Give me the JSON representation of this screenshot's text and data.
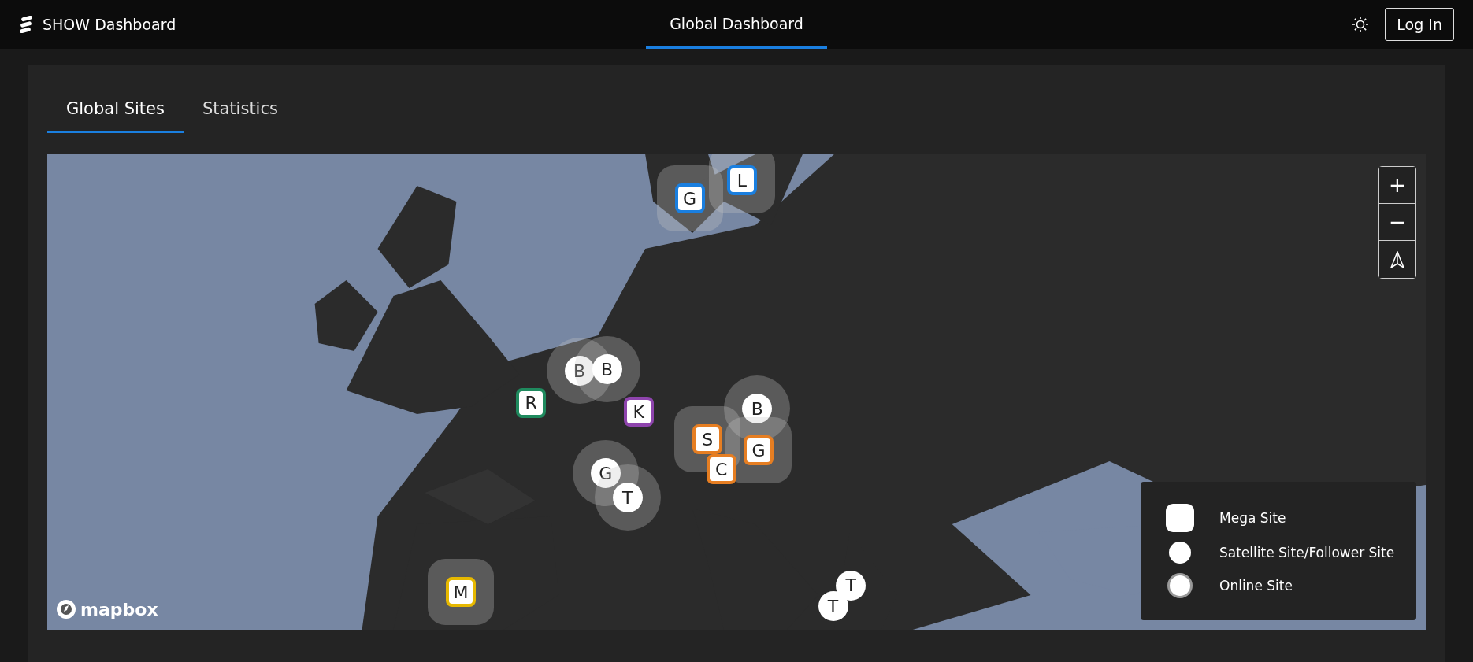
{
  "header": {
    "title": "SHOW Dashboard",
    "nav": [
      {
        "label": "Global Dashboard",
        "selected": true
      }
    ],
    "login": "Log In"
  },
  "tabs": [
    {
      "label": "Global Sites",
      "selected": true
    },
    {
      "label": "Statistics",
      "selected": false
    }
  ],
  "map": {
    "zoom_in": "+",
    "zoom_out": "−",
    "attribution": "mapbox",
    "sites": [
      {
        "letter": "G",
        "kind": "mega",
        "color": "#1a7fe0",
        "halo": true
      },
      {
        "letter": "L",
        "kind": "mega",
        "color": "#1a7fe0",
        "halo": true
      },
      {
        "letter": "B",
        "kind": "satellite",
        "halo": true
      },
      {
        "letter": "B",
        "kind": "satellite",
        "halo": true
      },
      {
        "letter": "R",
        "kind": "mega",
        "color": "#1f8a5e",
        "halo": false
      },
      {
        "letter": "K",
        "kind": "mega",
        "color": "#8e44ad",
        "halo": false
      },
      {
        "letter": "B",
        "kind": "satellite",
        "halo": true
      },
      {
        "letter": "S",
        "kind": "mega",
        "color": "#e67e22",
        "halo": true
      },
      {
        "letter": "G",
        "kind": "mega",
        "color": "#e67e22",
        "halo": true
      },
      {
        "letter": "C",
        "kind": "mega",
        "color": "#e67e22",
        "halo": false
      },
      {
        "letter": "G",
        "kind": "satellite",
        "halo": true
      },
      {
        "letter": "T",
        "kind": "satellite",
        "halo": true
      },
      {
        "letter": "M",
        "kind": "mega",
        "color": "#e6b800",
        "halo": true
      },
      {
        "letter": "T",
        "kind": "satellite",
        "halo": false
      },
      {
        "letter": "T",
        "kind": "satellite",
        "halo": false
      }
    ],
    "legend": [
      {
        "kind": "mega",
        "label": "Mega Site"
      },
      {
        "kind": "satellite",
        "label": "Satellite Site/Follower Site"
      },
      {
        "kind": "online",
        "label": "Online Site"
      }
    ]
  }
}
